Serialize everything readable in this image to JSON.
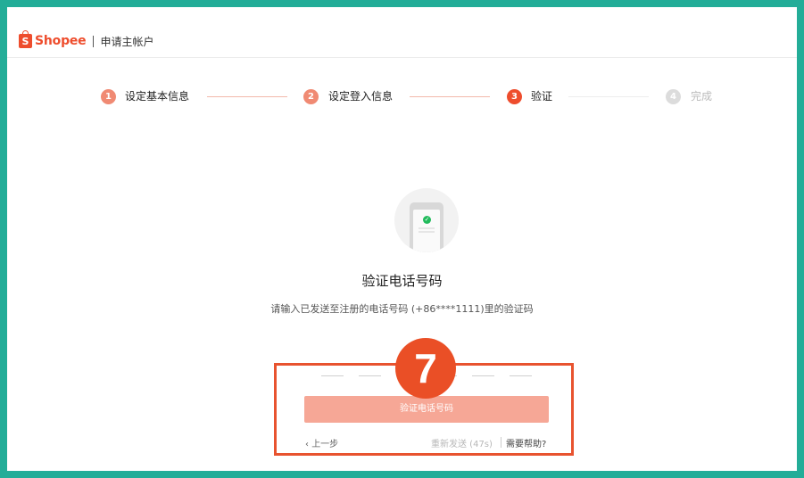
{
  "header": {
    "brand": "Shopee",
    "title": "申请主帐户"
  },
  "steps": [
    {
      "number": "1",
      "label": "设定基本信息",
      "status": "done"
    },
    {
      "number": "2",
      "label": "设定登入信息",
      "status": "done"
    },
    {
      "number": "3",
      "label": "验证",
      "status": "active"
    },
    {
      "number": "4",
      "label": "完成",
      "status": "pending"
    }
  ],
  "verify": {
    "title": "验证电话号码",
    "subtitle": "请输入已发送至注册的电话号码 (+86****1111)里的验证码",
    "otp_digits": [
      "",
      "",
      "",
      "",
      "",
      ""
    ],
    "button_label": "验证电话号码",
    "back_label": "上一步",
    "resend_label": "重新发送 (47s)",
    "help_label": "需要帮助?"
  },
  "annotation": {
    "number": "7"
  },
  "colors": {
    "brand": "#ee4d2d",
    "step_done": "#f08a73",
    "step_active": "#ee4d2d",
    "step_pending": "#dcdcdc",
    "button": "#f6a796",
    "annotation": "#e8532f",
    "frame": "#23ad98"
  },
  "icons": {
    "logo": "shopee-bag-icon",
    "illustration": "phone-check-icon",
    "back": "chevron-left-icon"
  }
}
